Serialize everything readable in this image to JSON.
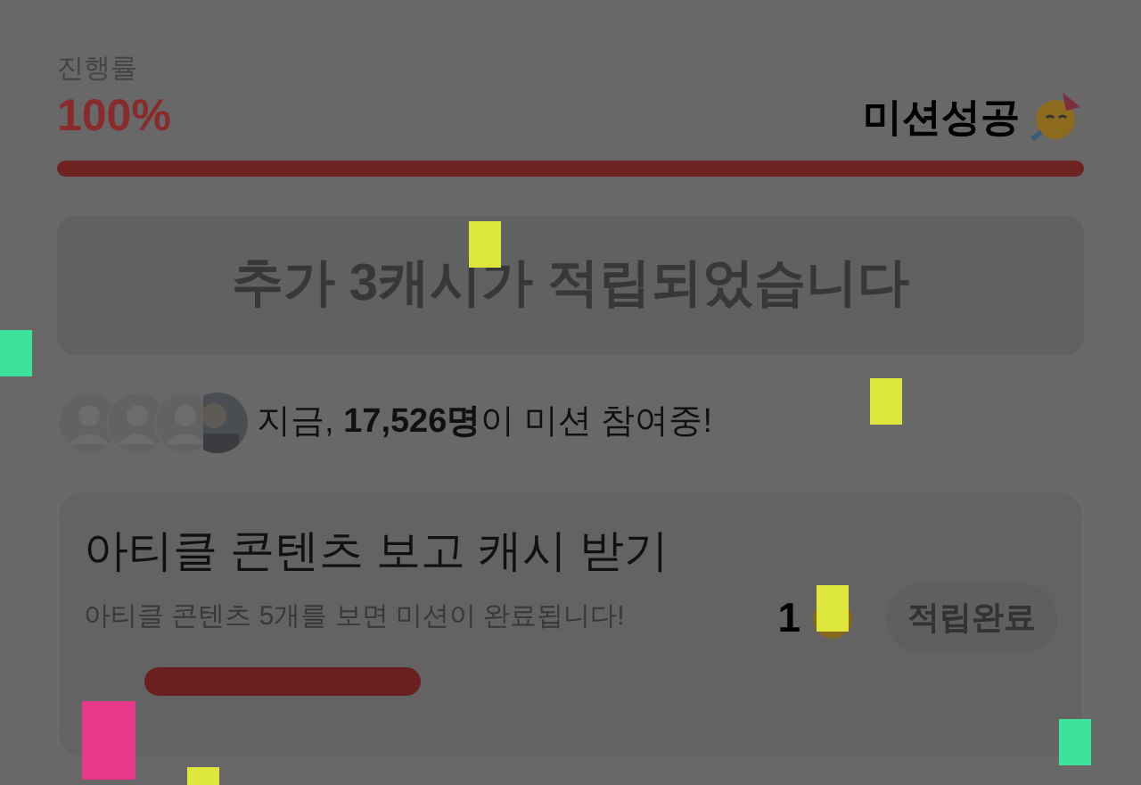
{
  "progress": {
    "label": "진행률",
    "value": "100%",
    "level": 1,
    "status": "미션성공"
  },
  "reward_banner": {
    "text": "추가 3캐시가 적립되었습니다"
  },
  "participants": {
    "text": "지금, **17,526명**이 미션 참여중!"
  },
  "mission": {
    "title": "아티클 콘텐츠 보고 캐시 받기",
    "description": "아티클 콘텐츠 5개를 보면 미션이 완료됩니다!",
    "reward": "1",
    "button": "적립완료",
    "completed": true
  }
}
